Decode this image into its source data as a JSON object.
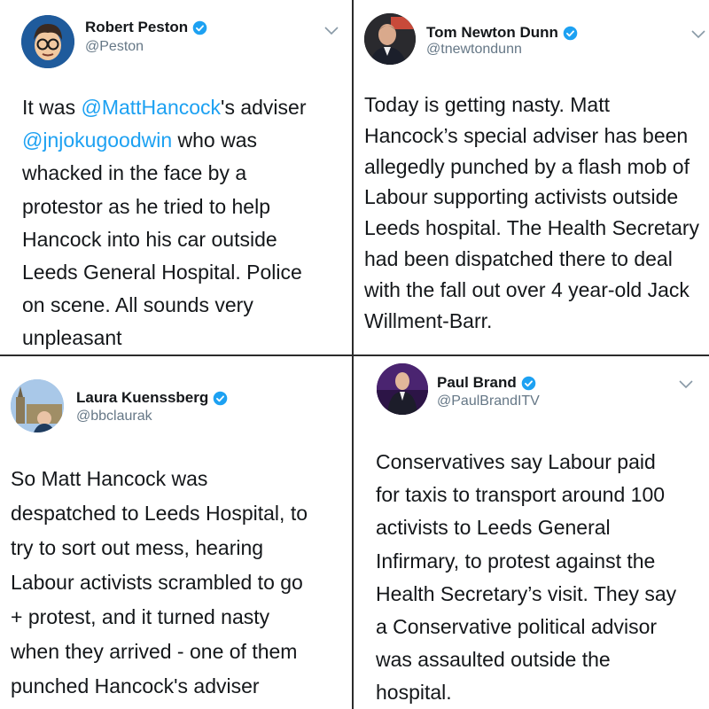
{
  "tweets": [
    {
      "name": "Robert Peston",
      "handle": "@Peston",
      "lines": [
        {
          "mention": "@MattHancock",
          "pre": "It was ",
          "post": "'s adviser"
        },
        {
          "mention": "@jnjokugoodwin",
          "pre": "",
          "post": " who was"
        },
        "whacked in the face by a",
        "protestor as he tried to help",
        "Hancock into his car outside",
        "Leeds General Hospital. Police",
        "on scene. All sounds very",
        "unpleasant"
      ]
    },
    {
      "name": "Tom Newton Dunn",
      "handle": "@tnewtondunn",
      "lines": [
        "Today is getting nasty. Matt",
        "Hancock’s special adviser has been",
        "allegedly punched by a flash mob of",
        "Labour supporting activists outside",
        "Leeds hospital. The Health Secretary",
        "had been dispatched there to deal",
        "with the fall out over 4 year-old Jack",
        "Willment-Barr."
      ]
    },
    {
      "name": "Laura Kuenssberg",
      "handle": "@bbclaurak",
      "lines": [
        "So Matt Hancock was",
        "despatched to Leeds Hospital, to",
        "try to sort out mess, hearing",
        "Labour activists scrambled to go",
        "+ protest, and it turned nasty",
        "when they arrived - one of them",
        "punched Hancock's adviser"
      ]
    },
    {
      "name": "Paul Brand",
      "handle": "@PaulBrandITV",
      "lines": [
        "Conservatives say Labour paid",
        "for taxis to transport around 100",
        "activists to Leeds General",
        "Infirmary, to protest against the",
        "Health Secretary’s visit. They say",
        "a Conservative political advisor",
        "was assaulted outside the",
        "hospital."
      ]
    }
  ],
  "icons": {
    "verified": "verified-badge-icon",
    "menu": "chevron-down-icon"
  },
  "colors": {
    "mention": "#1da1f2",
    "verified": "#1da1f2",
    "handle": "#657786",
    "text": "#14171a",
    "divider": "#2b2b2b"
  }
}
